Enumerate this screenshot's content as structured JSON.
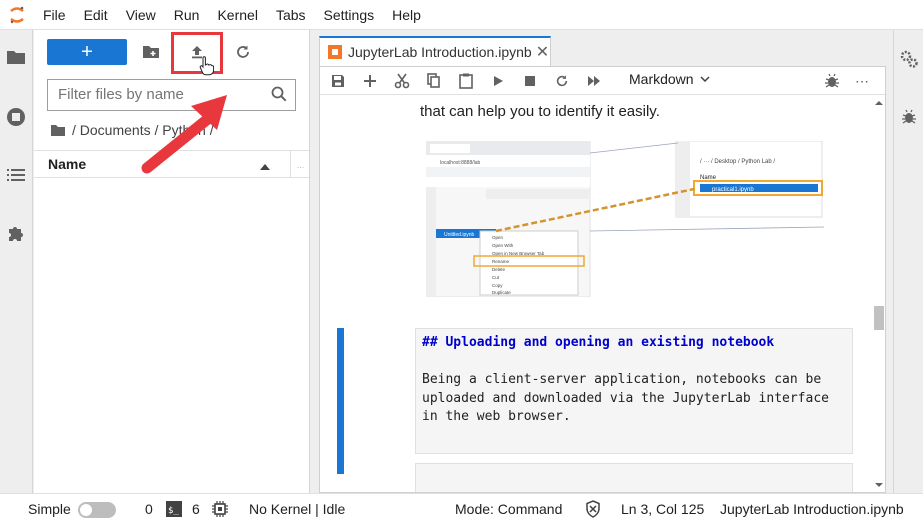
{
  "menubar": {
    "items": [
      "File",
      "Edit",
      "View",
      "Run",
      "Kernel",
      "Tabs",
      "Settings",
      "Help"
    ]
  },
  "filebrowser": {
    "new_label": "+",
    "filter_placeholder": "Filter files by name",
    "breadcrumb": "/ Documents / Python /",
    "column_name": "Name",
    "column_more": "..."
  },
  "notebook": {
    "tab_title": "JupyterLab Introduction.ipynb",
    "cell_type": "Markdown",
    "paragraph_tail": "that can help you to identify it easily.",
    "markdown_heading": "## Uploading and opening an existing notebook",
    "markdown_body": "Being a client-server application, notebooks can be\nuploaded and downloaded via the JupyterLab interface\nin the web browser."
  },
  "embedded_screenshot": {
    "left_url": "localhost:8888/lab",
    "right_breadcrumb": "/ ··· / Desktop / Python Lab /",
    "right_name_header": "Name",
    "right_file": "practical1.ipynb",
    "context_menu": [
      "Open",
      "Open With",
      "Open in New Browser Tab",
      "Rename",
      "Delete",
      "Cut",
      "Copy",
      "Duplicate"
    ],
    "left_file": "Untitled.ipynb"
  },
  "statusbar": {
    "simple_label": "Simple",
    "terminals_count": "0",
    "kernels_count": "6",
    "kernel_status": "No Kernel | Idle",
    "mode": "Mode: Command",
    "position": "Ln 3, Col 125",
    "filename": "JupyterLab Introduction.ipynb"
  },
  "colors": {
    "accent": "#1976d2",
    "highlight": "#e8383d",
    "orange": "#f37726"
  }
}
